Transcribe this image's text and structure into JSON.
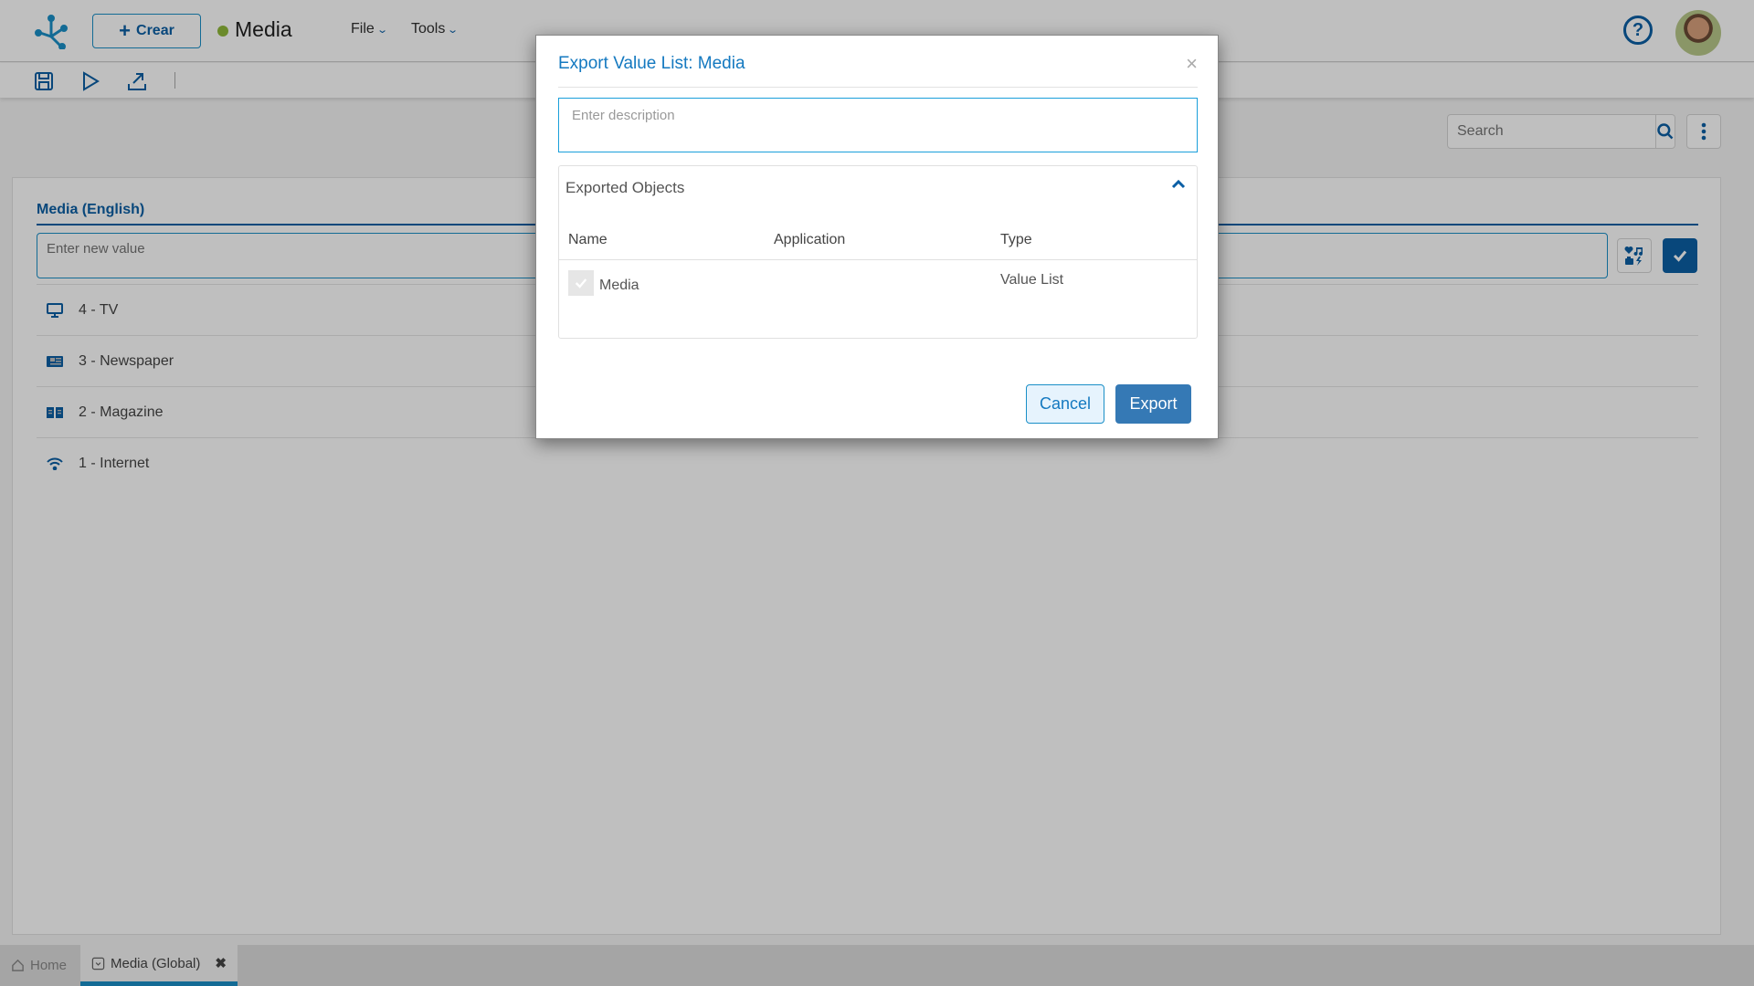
{
  "header": {
    "create_label": "Crear",
    "app_title": "Media",
    "status_color": "#8fb83a",
    "menus": [
      {
        "label": "File"
      },
      {
        "label": "Tools"
      }
    ],
    "help_icon": "question-circle-icon",
    "avatar_icon": "user-avatar"
  },
  "toolbar": {
    "icons": [
      "save-icon",
      "play-icon",
      "export-icon"
    ]
  },
  "search": {
    "placeholder": "Search"
  },
  "main": {
    "section_title": "Media (English)",
    "new_value_placeholder": "Enter new value",
    "items": [
      {
        "label": "4 - TV",
        "icon": "tv-icon"
      },
      {
        "label": "3 - Newspaper",
        "icon": "newspaper-icon"
      },
      {
        "label": "2 - Magazine",
        "icon": "book-open-icon"
      },
      {
        "label": "1 - Internet",
        "icon": "wifi-icon"
      }
    ]
  },
  "bottom_tabs": [
    {
      "label": "Home",
      "icon": "home-icon"
    },
    {
      "label": "Media (Global)",
      "icon": "value-list-icon",
      "active": true
    }
  ],
  "modal": {
    "title": "Export Value List: Media",
    "description_placeholder": "Enter description",
    "exported_objects_title": "Exported Objects",
    "columns": [
      "Name",
      "Application",
      "Type"
    ],
    "rows": [
      {
        "checked": true,
        "name": "Media",
        "application": "",
        "type": "Value List"
      }
    ],
    "cancel_label": "Cancel",
    "export_label": "Export"
  },
  "colors": {
    "primary": "#0b5fa5",
    "accent": "#1a8fc7",
    "export_button": "#3579b5"
  }
}
